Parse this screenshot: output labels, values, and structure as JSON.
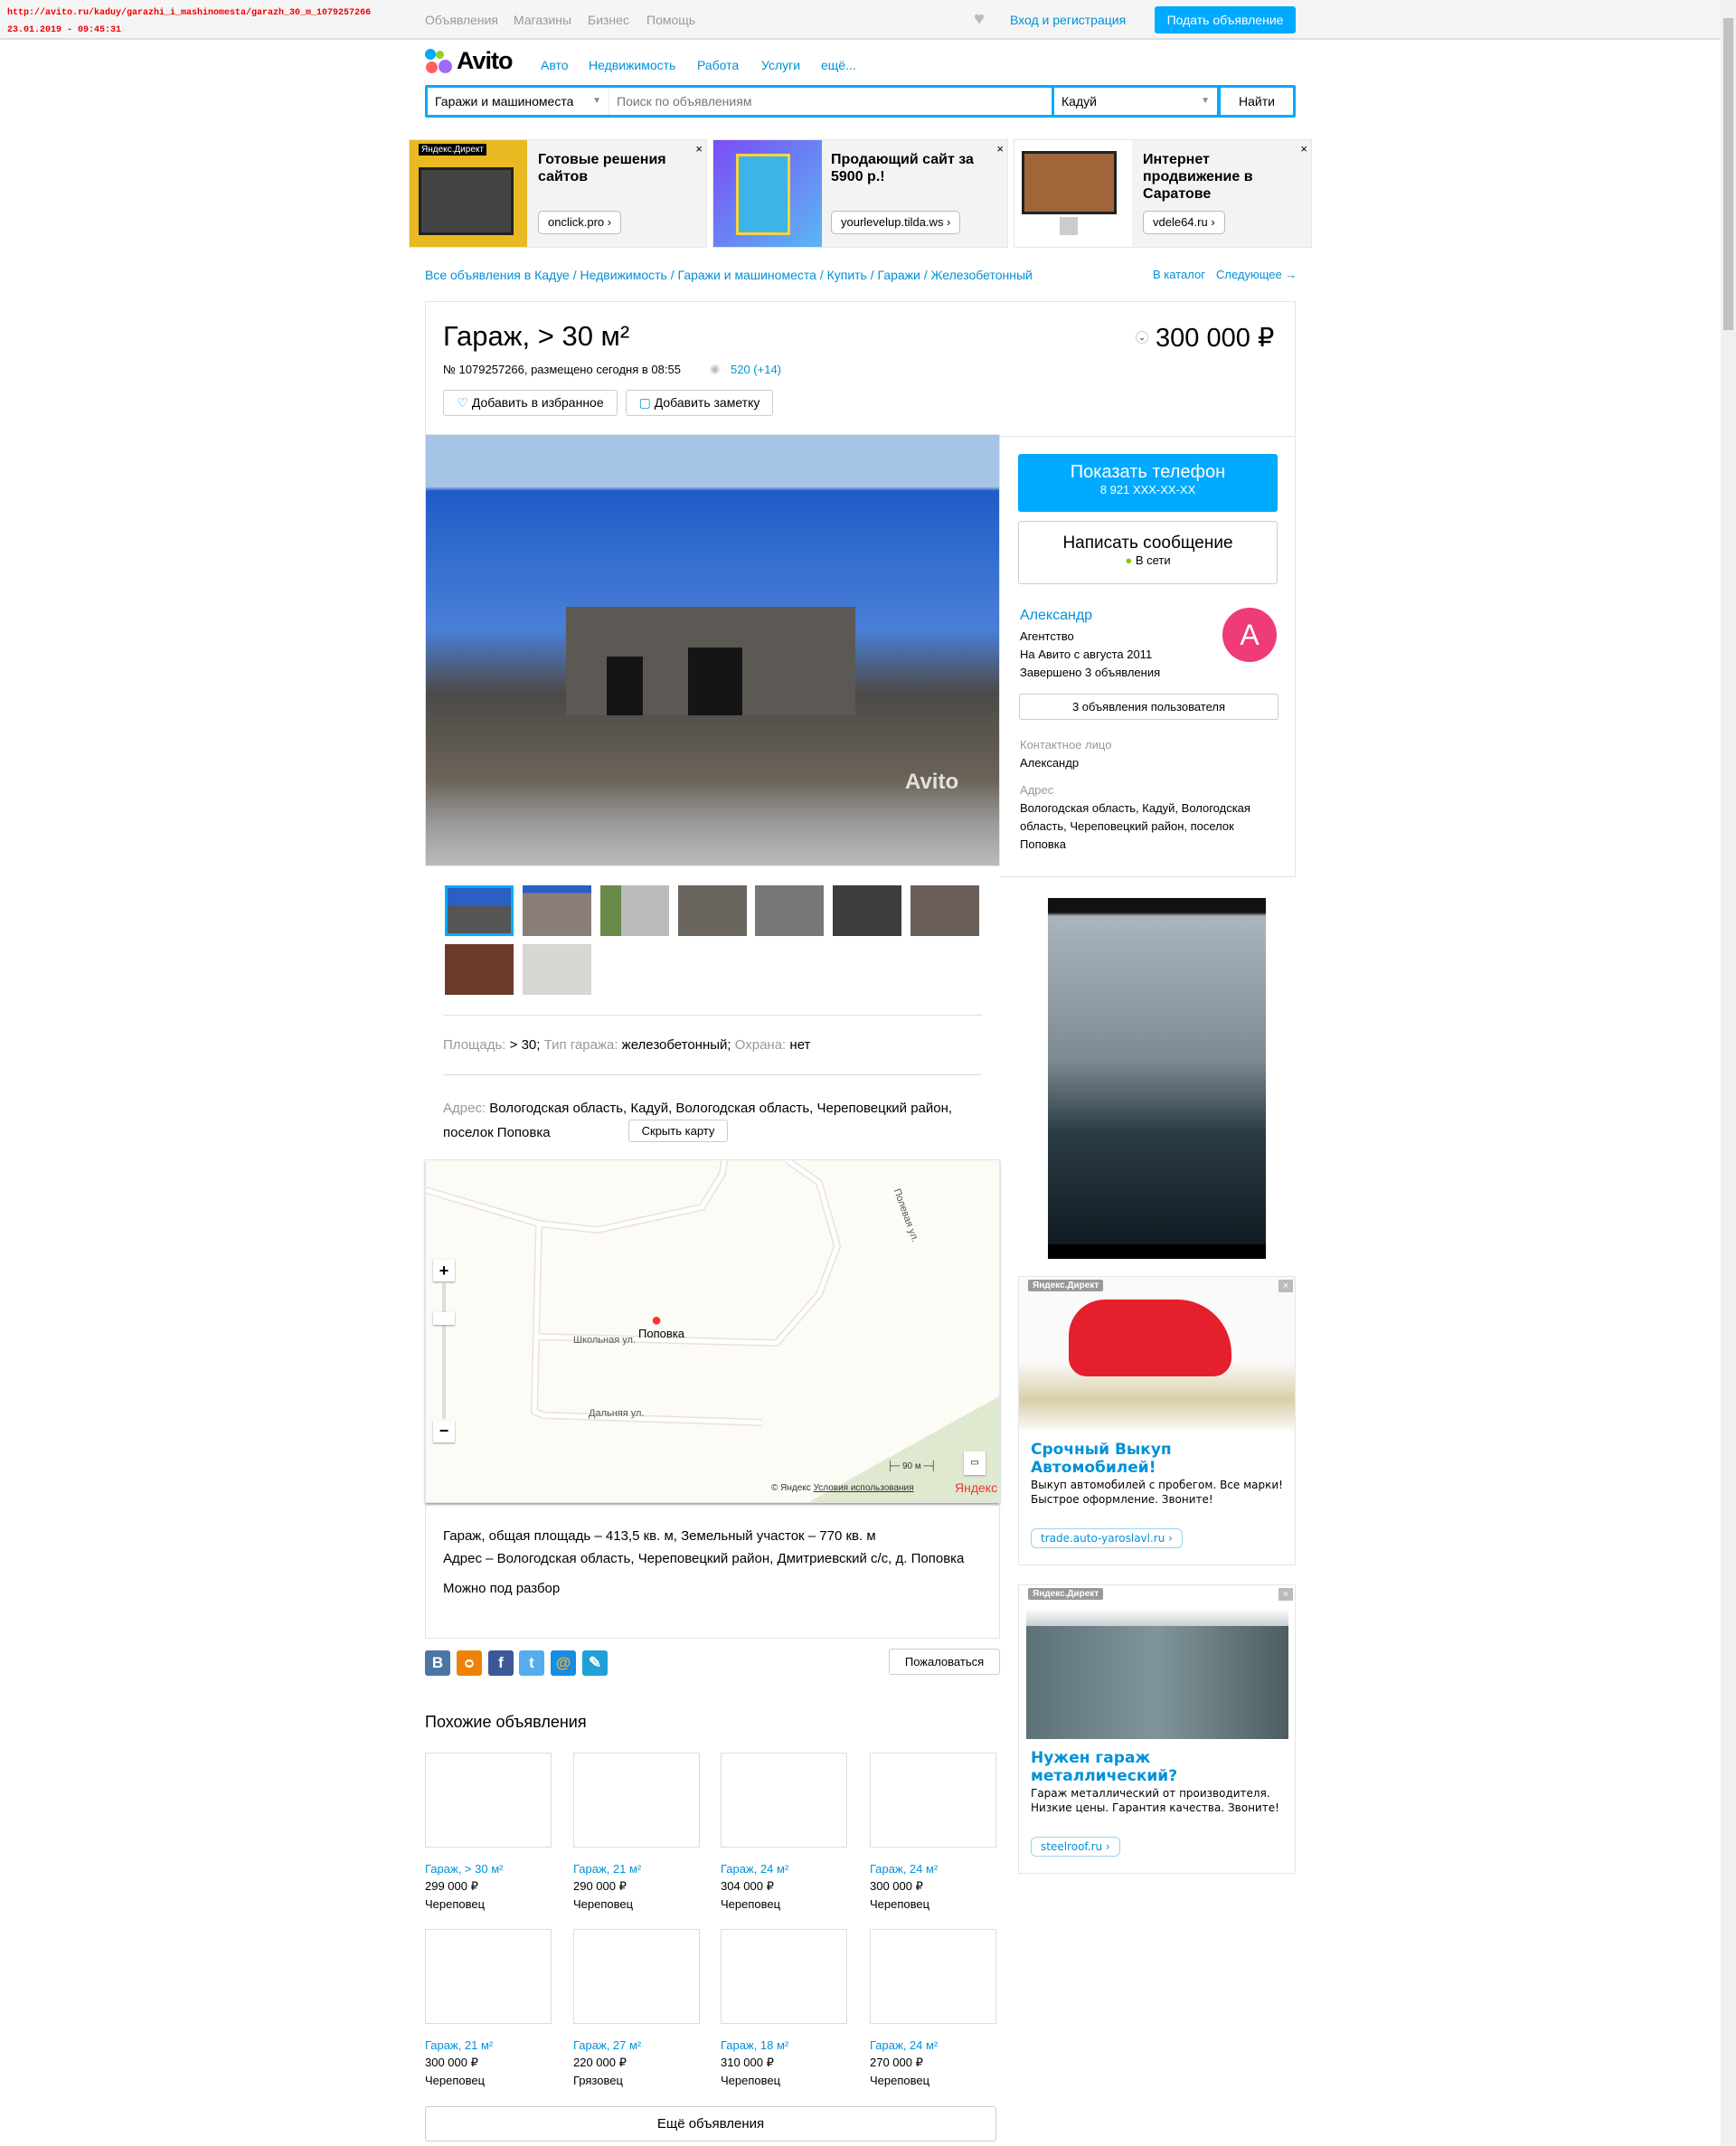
{
  "capture": {
    "url": "http://avito.ru/kaduy/garazhi_i_mashinomesta/garazh_30_m_1079257266",
    "timestamp": "23.01.2019 - 09:45:31"
  },
  "topbar": {
    "links": [
      "Объявления",
      "Магазины",
      "Бизнес",
      "Помощь"
    ],
    "login": "Вход и регистрация",
    "post_ad": "Подать объявление"
  },
  "header": {
    "logo": "Avito",
    "nav": [
      "Авто",
      "Недвижимость",
      "Работа",
      "Услуги",
      "ещё..."
    ]
  },
  "search": {
    "category": "Гаражи и машиноместа",
    "placeholder": "Поиск по объявлениям",
    "city": "Кадуй",
    "submit": "Найти"
  },
  "top_ads": [
    {
      "badge": "Яндекс.Директ",
      "title": "Готовые решения сайтов",
      "link": "onclick.pro ›",
      "close": "×"
    },
    {
      "title": "Продающий сайт за 5900 р.!",
      "link": "yourlevelup.tilda.ws ›",
      "close": "×"
    },
    {
      "title": "Интернет продвижение в Саратове",
      "link": "vdele64.ru ›",
      "close": "×"
    }
  ],
  "breadcrumbs": [
    "Все объявления в Кадуе",
    "Недвижимость",
    "Гаражи и машиноместа",
    "Купить",
    "Гаражи",
    "Железобетонный"
  ],
  "breadcrumb_sep": " / ",
  "catalog_links": {
    "catalog": "В каталог",
    "next": "Следующее →"
  },
  "listing": {
    "title": "Гараж, > 30 м²",
    "price": "300 000 ₽",
    "meta": "№ 1079257266, размещено сегодня в 08:55",
    "views": "520 (+14)",
    "add_favorite": "Добавить в избранное",
    "add_note": "Добавить заметку",
    "watermark": "Avito",
    "thumb_count": 9,
    "params": [
      {
        "label": "Площадь:",
        "value": "> 30"
      },
      {
        "label": "Тип гаража:",
        "value": "железобетонный"
      },
      {
        "label": "Охрана:",
        "value": "нет"
      }
    ],
    "address_label": "Адрес:",
    "address": "Вологодская область, Кадуй, Вологодская область, Череповецкий район, поселок Поповка",
    "hide_map": "Скрыть карту",
    "description": [
      "Гараж, общая площадь – 413,5 кв. м, Земельный участок – 770 кв. м",
      "Адрес – Вологодская область, Череповецкий район, Дмитриевский с/с, д. Поповка",
      "Можно под разбор"
    ],
    "complain": "Пожаловаться"
  },
  "map": {
    "place": "Поповка",
    "streets": [
      "Школьная ул.",
      "Дальняя ул.",
      "Полевая ул."
    ],
    "scale": "90 м",
    "copyright": "© Яндекс",
    "terms": "Условия использования",
    "brand": "Яндекс"
  },
  "share": [
    "В",
    "ok",
    "f",
    "t",
    "@",
    "lj"
  ],
  "seller": {
    "show_phone": "Показать телефон",
    "phone": "8 921 XXX-XX-XX",
    "message": "Написать сообщение",
    "online": "В сети",
    "name": "Александр",
    "type": "Агентство",
    "since": "На Авито с августа 2011",
    "completed": "Завершено 3 объявления",
    "avatar_letter": "А",
    "user_ads": "3 объявления пользователя",
    "contact_label": "Контактное лицо",
    "contact": "Александр",
    "address_label": "Адрес",
    "address": "Вологодская область, Кадуй, Вологодская область, Череповецкий район, поселок Поповка"
  },
  "side_ads": [
    {
      "badge": "Яндекс.Директ",
      "title": "Срочный Выкуп Автомобилей!",
      "text": "Выкуп автомобилей с пробегом. Все марки! Быстрое оформление. Звоните!",
      "link": "trade.auto-yaroslavl.ru ›"
    },
    {
      "badge": "Яндекс.Директ",
      "title": "Нужен гараж металлический?",
      "text": "Гараж металлический от производителя. Низкие цены. Гарантия качества. Звоните!",
      "link": "steelroof.ru ›"
    }
  ],
  "similar": {
    "heading": "Похожие объявления",
    "more": "Ещё объявления",
    "items": [
      {
        "title": "Гараж, > 30 м²",
        "price": "299 000 ₽",
        "city": "Череповец"
      },
      {
        "title": "Гараж, 21 м²",
        "price": "290 000 ₽",
        "city": "Череповец"
      },
      {
        "title": "Гараж, 24 м²",
        "price": "304 000 ₽",
        "city": "Череповец"
      },
      {
        "title": "Гараж, 24 м²",
        "price": "300 000 ₽",
        "city": "Череповец"
      },
      {
        "title": "Гараж, 21 м²",
        "price": "300 000 ₽",
        "city": "Череповец"
      },
      {
        "title": "Гараж, 27 м²",
        "price": "220 000 ₽",
        "city": "Грязовец"
      },
      {
        "title": "Гараж, 18 м²",
        "price": "310 000 ₽",
        "city": "Череповец"
      },
      {
        "title": "Гараж, 24 м²",
        "price": "270 000 ₽",
        "city": "Череповец"
      }
    ]
  },
  "colors": {
    "accent": "#00aaff",
    "link": "#0091d9",
    "avatar": "#ef3b78",
    "online": "#86c800"
  }
}
